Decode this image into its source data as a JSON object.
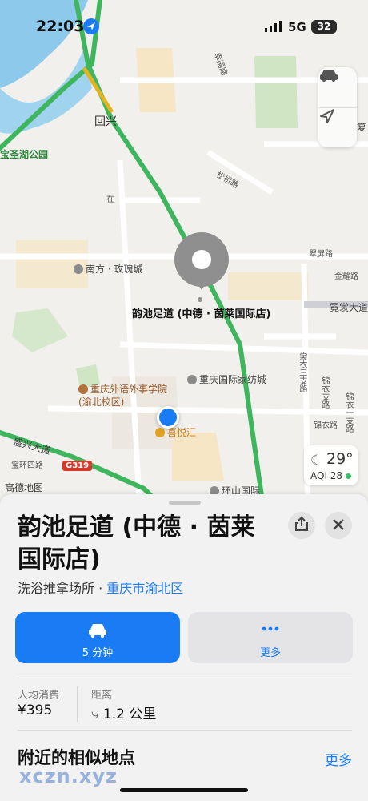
{
  "status_bar": {
    "time": "22:03",
    "network": "5G",
    "battery": "32"
  },
  "map": {
    "labels": {
      "huixing": "回兴",
      "baoshenghu_park": "宝圣湖公园",
      "xingfu_rd": "幸福路",
      "fu": "复",
      "songqiao_rd": "松桥路",
      "zai": "在",
      "nanfang_meiguicheng": "南方 · 玫瑰城",
      "cuiping_rd": "翠屏路",
      "jinyao_rd": "金耀路",
      "nichang_ave": "霓裳大道",
      "chongqing_foreign_school": "重庆外语外事学院(渝北校区)",
      "chongqing_textile_city": "重庆国际家纺城",
      "xiyuehui": "喜悦汇",
      "shengxing_ave": "盛兴大道",
      "baohuan_rd": "宝环四路",
      "gaode_map": "高德地图",
      "g319": "G319",
      "huanshan_intl": "环山国际",
      "shangyi_rd": "裳衣三支路",
      "shangyi_rd2": "锦衣支路",
      "jinyi_rd": "锦衣路",
      "jinyi_rd2": "锦衣一支路"
    },
    "pin_label": "韵池足道 (中德 · 茵莱国际店)",
    "weather": {
      "temp": "29°",
      "aqi": "AQI 28"
    }
  },
  "sheet": {
    "title": "韵池足道 (中德 · 茵莱国际店)",
    "category": "洗浴推拿场所",
    "separator": " · ",
    "location_link": "重庆市渝北区",
    "drive_button": "5 分钟",
    "more_button": "更多",
    "avg_spend_label": "人均消费",
    "avg_spend_value": "¥395",
    "distance_label": "距离",
    "distance_value": "1.2 公里",
    "nearby_title": "附近的相似地点",
    "nearby_more": "更多",
    "watermark": "xczn.xyz"
  }
}
